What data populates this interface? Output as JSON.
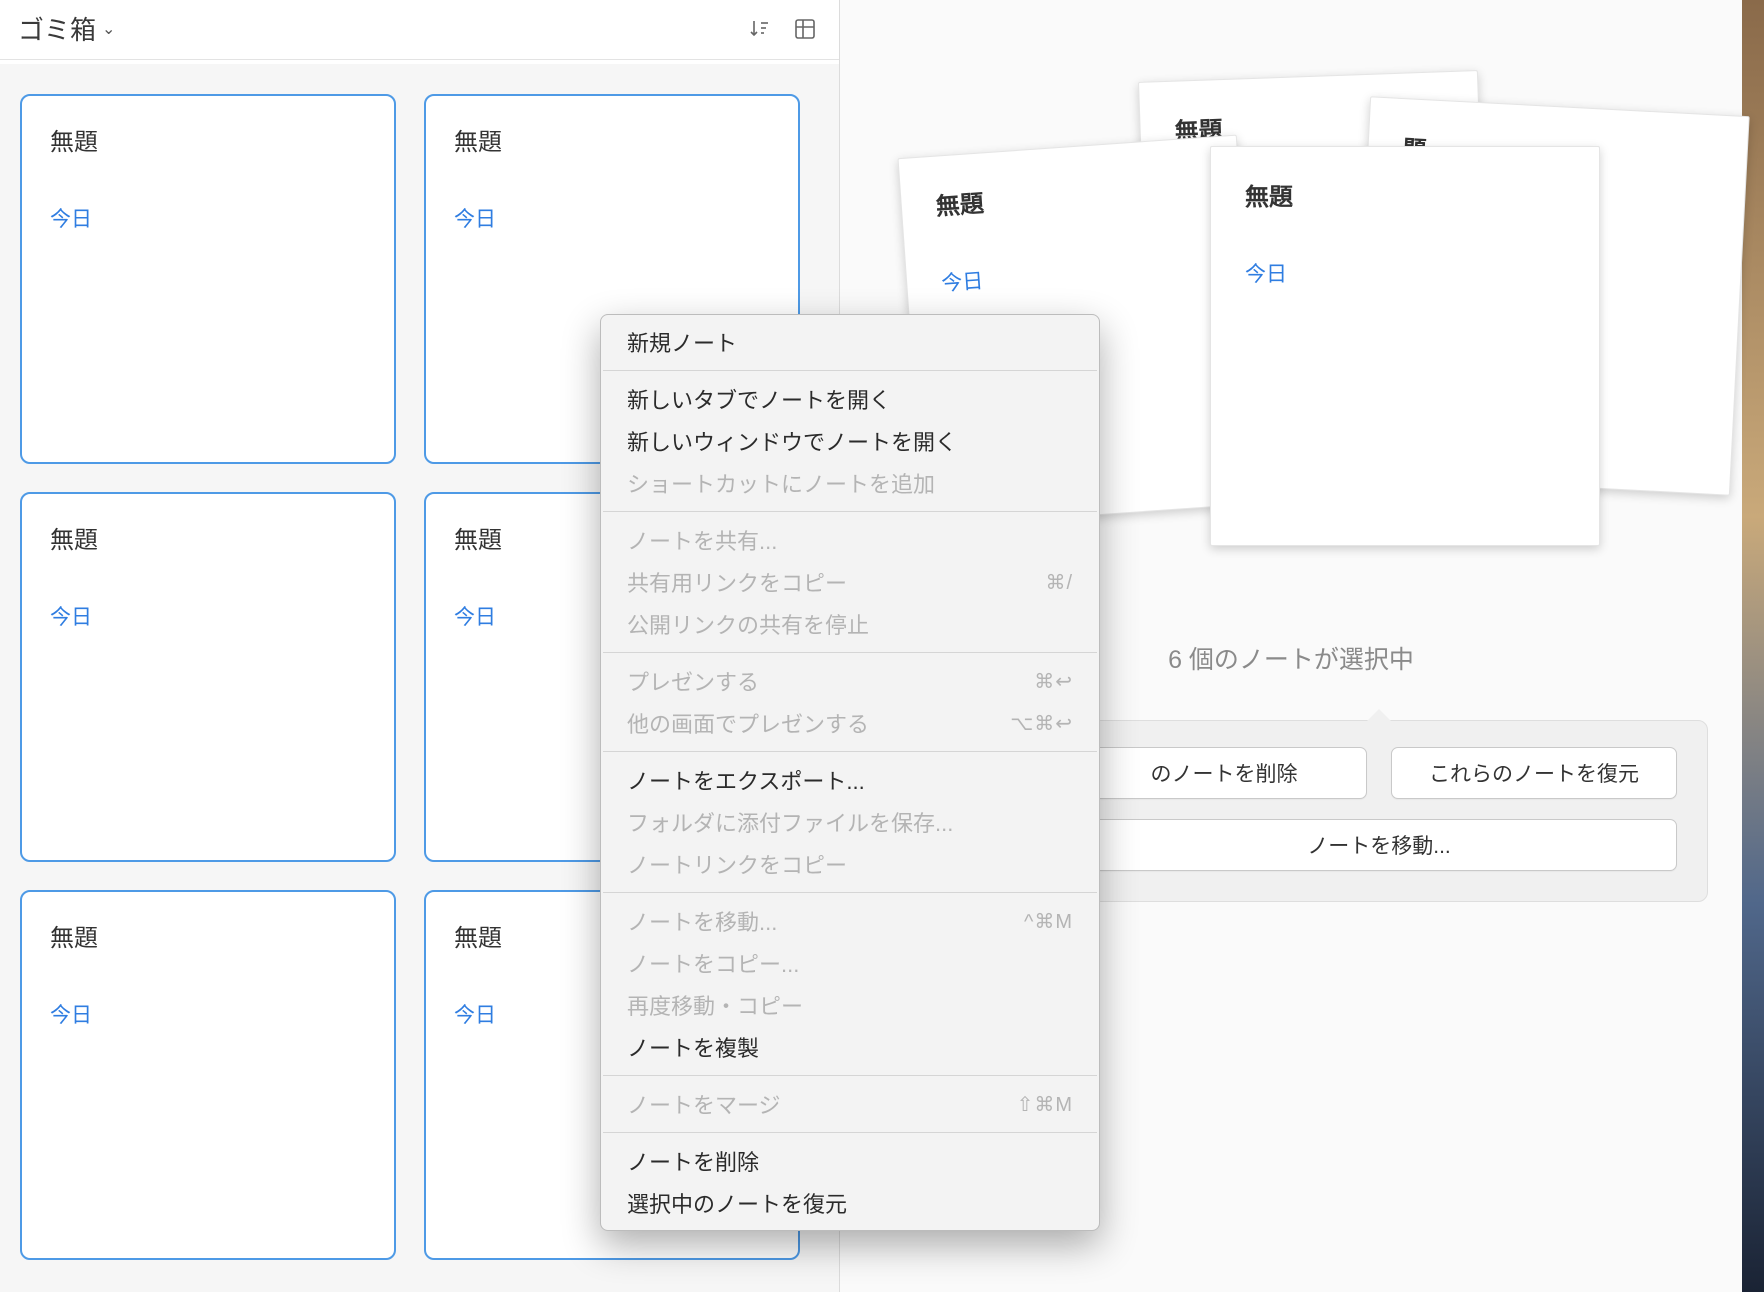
{
  "header": {
    "title": "ゴミ箱",
    "sort_icon": "sort-icon",
    "view_icon": "view-grid-icon"
  },
  "notes": [
    {
      "title": "無題",
      "date": "今日"
    },
    {
      "title": "無題",
      "date": "今日"
    },
    {
      "title": "無題",
      "date": "今日"
    },
    {
      "title": "無題",
      "date": "今日"
    },
    {
      "title": "無題",
      "date": "今日"
    },
    {
      "title": "無題",
      "date": "今日"
    }
  ],
  "stack": {
    "back1_title": "無題",
    "back2_title": "題",
    "left_title": "無題",
    "left_date": "今日",
    "front_title": "無題",
    "front_date": "今日"
  },
  "selection_label": "6 個のノートが選択中",
  "actions": {
    "delete": "のノートを削除",
    "restore": "これらのノートを復元",
    "move": "ノートを移動..."
  },
  "menu": {
    "new_note": "新規ノート",
    "open_tab": "新しいタブでノートを開く",
    "open_window": "新しいウィンドウでノートを開く",
    "add_shortcut": "ショートカットにノートを追加",
    "share": "ノートを共有...",
    "copy_share_link": "共有用リンクをコピー",
    "copy_share_link_sc": "⌘/",
    "stop_public": "公開リンクの共有を停止",
    "present": "プレゼンする",
    "present_sc": "⌘↩",
    "present_other": "他の画面でプレゼンする",
    "present_other_sc": "⌥⌘↩",
    "export": "ノートをエクスポート...",
    "save_attach": "フォルダに添付ファイルを保存...",
    "copy_link": "ノートリンクをコピー",
    "move_to": "ノートを移動...",
    "move_to_sc": "^⌘M",
    "copy_to": "ノートをコピー...",
    "move_copy_again": "再度移動・コピー",
    "duplicate": "ノートを複製",
    "merge": "ノートをマージ",
    "merge_sc": "⇧⌘M",
    "delete": "ノートを削除",
    "restore_selected": "選択中のノートを復元"
  }
}
